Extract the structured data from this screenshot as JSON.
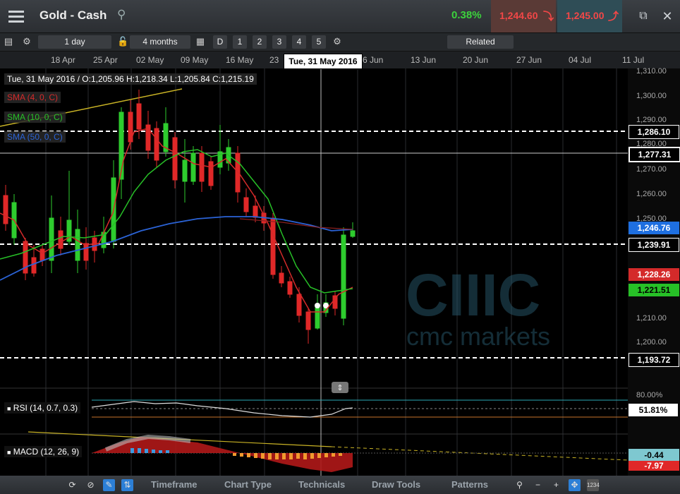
{
  "header": {
    "title": "Gold - Cash",
    "change_pct": "0.38%",
    "sell_price": "1,244.60",
    "buy_price": "1,245.00"
  },
  "toolbar": {
    "interval": "1 day",
    "range": "4 months",
    "periods": [
      "D",
      "1",
      "2",
      "3",
      "4",
      "5"
    ],
    "related": "Related"
  },
  "date_axis": {
    "ticks": [
      "18 Apr",
      "25 Apr",
      "02 May",
      "09 May",
      "16 May",
      "23",
      "6 Jun",
      "13 Jun",
      "20 Jun",
      "27 Jun",
      "04 Jul",
      "11 Jul"
    ],
    "cursor_label": "Tue, 31 May 2016"
  },
  "ohlc": {
    "text": "Tue, 31 May 2016 / O:1,205.96  H:1,218.34  L:1,205.84  C:1,215.19"
  },
  "legends": {
    "sma4": "SMA (4, 0, C)",
    "sma10": "SMA (10, 0, C)",
    "sma50": "SMA (50, 0, C)"
  },
  "price_axis": {
    "ticks": [
      "1,310.00",
      "1,300.00",
      "1,290.00",
      "1,280.00",
      "1,270.00",
      "1,260.00",
      "1,250.00",
      "1,210.00",
      "1,200.00"
    ],
    "levels": {
      "l1": "1,286.10",
      "l2": "1,277.31",
      "l3": "1,246.76",
      "l4": "1,239.91",
      "l5": "1,228.26",
      "l6": "1,221.51",
      "l7": "1,193.72"
    }
  },
  "rsi": {
    "label": "RSI (14, 0.7, 0.3)",
    "top_level": "80.00%",
    "value": "51.81%"
  },
  "macd": {
    "label": "MACD (12, 26, 9)",
    "value1": "-0.44",
    "value2": "-7.97"
  },
  "watermark": {
    "logo": "CIIIC",
    "text": "cmc markets"
  },
  "bottom_bar": {
    "tabs": [
      "Timeframe",
      "Chart Type",
      "Technicals",
      "Draw Tools",
      "Patterns"
    ]
  },
  "colors": {
    "up": "#2ecc2e",
    "down": "#e02828",
    "sma4": "#d42a2a",
    "sma10": "#27c027",
    "sma50": "#2b63d6"
  }
}
